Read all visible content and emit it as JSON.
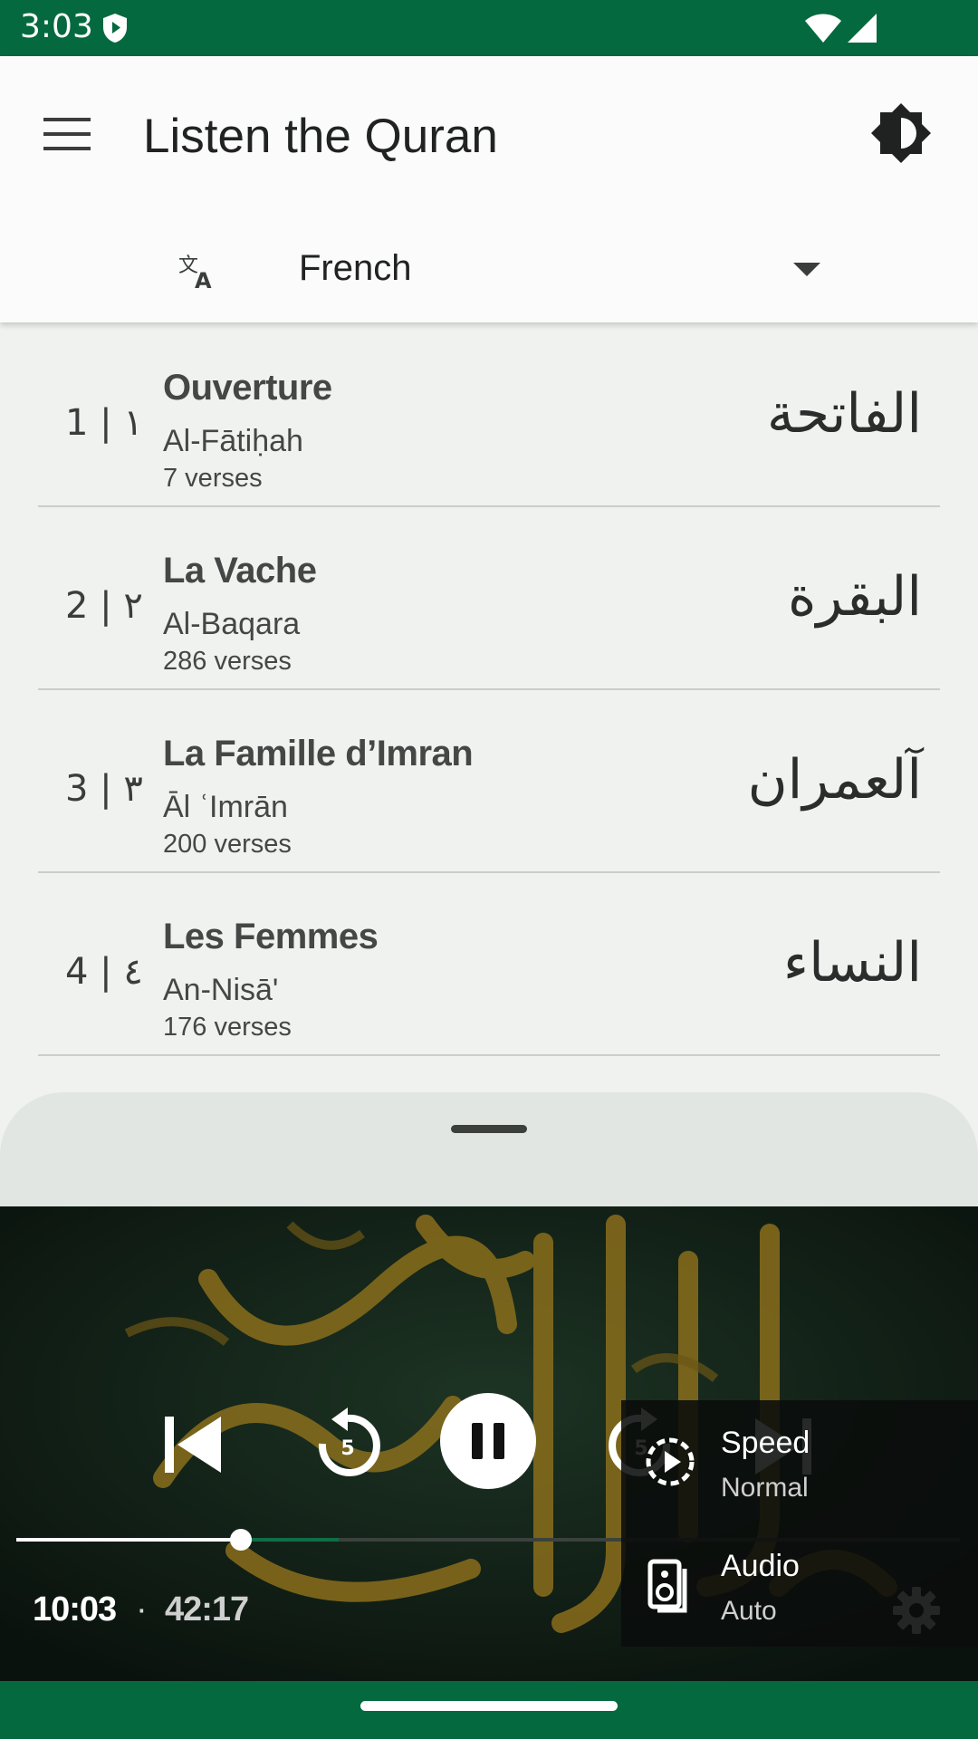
{
  "status": {
    "time": "3:03"
  },
  "app": {
    "title": "Listen the Quran",
    "language": "French"
  },
  "surahs": [
    {
      "num": "1 | ١",
      "name": "Ouverture",
      "translit": "Al-Fātiḥah",
      "verses": "7 verses",
      "arabic": "الفاتحة"
    },
    {
      "num": "2 | ٢",
      "name": "La Vache",
      "translit": "Al-Baqara",
      "verses": "286 verses",
      "arabic": "البقرة"
    },
    {
      "num": "3 | ٣",
      "name": "La Famille d’Imran",
      "translit": "Āl ʿImrān",
      "verses": "200 verses",
      "arabic": "آلعمران"
    },
    {
      "num": "4 | ٤",
      "name": "Les Femmes",
      "translit": "An-Nisā'",
      "verses": "176 verses",
      "arabic": "النساء"
    }
  ],
  "player": {
    "current_time": "10:03",
    "separator": "·",
    "total_time": "42:17",
    "progress_fraction": 0.238,
    "buffered_fraction": 0.342,
    "rewind_seconds": "5",
    "forward_seconds": "5"
  },
  "settings_menu": {
    "speed_label": "Speed",
    "speed_value": "Normal",
    "audio_label": "Audio",
    "audio_value": "Auto"
  },
  "colors": {
    "accent_green": "#04693f",
    "calligraphy_gold": "#8a6e1c"
  },
  "icons": [
    "shield-icon",
    "wifi-icon",
    "signal-icon",
    "menu-icon",
    "brightness-icon",
    "translate-icon",
    "dropdown-icon",
    "previous-icon",
    "rewind-icon",
    "pause-icon",
    "forward-icon",
    "next-icon",
    "speed-icon",
    "audio-track-icon",
    "settings-icon"
  ]
}
